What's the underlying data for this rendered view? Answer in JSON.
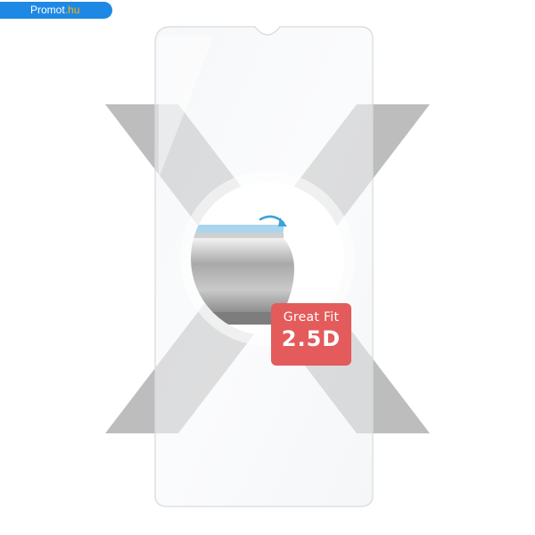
{
  "store_badge": {
    "brand": "Promot",
    "domain_suffix": ".hu",
    "color": "#1e88e5"
  },
  "product": {
    "type_icon": "tempered-glass-screen-protector",
    "feature_badge": {
      "line1": "Great Fit",
      "line2": "2.5D",
      "color": "#e35b5b"
    }
  }
}
